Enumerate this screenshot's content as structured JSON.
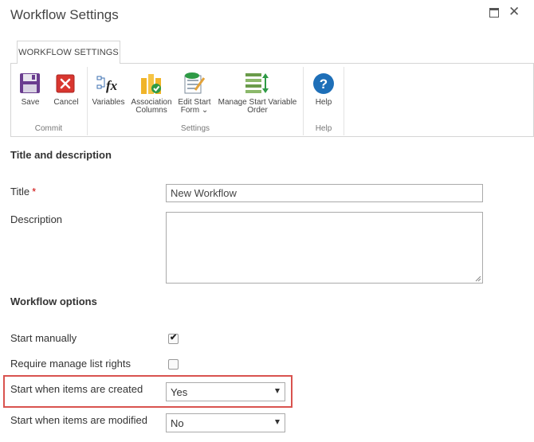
{
  "dialog": {
    "title": "Workflow Settings"
  },
  "ribbon": {
    "tab_label": "WORKFLOW SETTINGS",
    "groups": {
      "commit": "Commit",
      "settings": "Settings",
      "help": "Help"
    },
    "buttons": {
      "save": "Save",
      "cancel": "Cancel",
      "variables": "Variables",
      "association_columns_1": "Association",
      "association_columns_2": "Columns",
      "edit_start_form_1": "Edit Start",
      "edit_start_form_2": "Form",
      "manage_start_variable_order_1": "Manage Start Variable",
      "manage_start_variable_order_2": "Order",
      "help": "Help"
    }
  },
  "form": {
    "title_section": "Title and description",
    "title_label": "Title",
    "required_marker": "*",
    "title_value": "New Workflow",
    "description_label": "Description",
    "description_value": "",
    "options_section": "Workflow options",
    "start_manually_label": "Start manually",
    "start_manually_checked": true,
    "require_manage_list_rights_label": "Require manage list rights",
    "require_manage_list_rights_checked": false,
    "start_when_created_label": "Start when items are created",
    "start_when_created_value": "Yes",
    "start_when_modified_label": "Start when items are modified",
    "start_when_modified_value": "No"
  },
  "colors": {
    "highlight": "#d9534f",
    "help_blue": "#1e6fb8",
    "cancel_red": "#d9362f",
    "save_purple": "#6a3d8f"
  }
}
